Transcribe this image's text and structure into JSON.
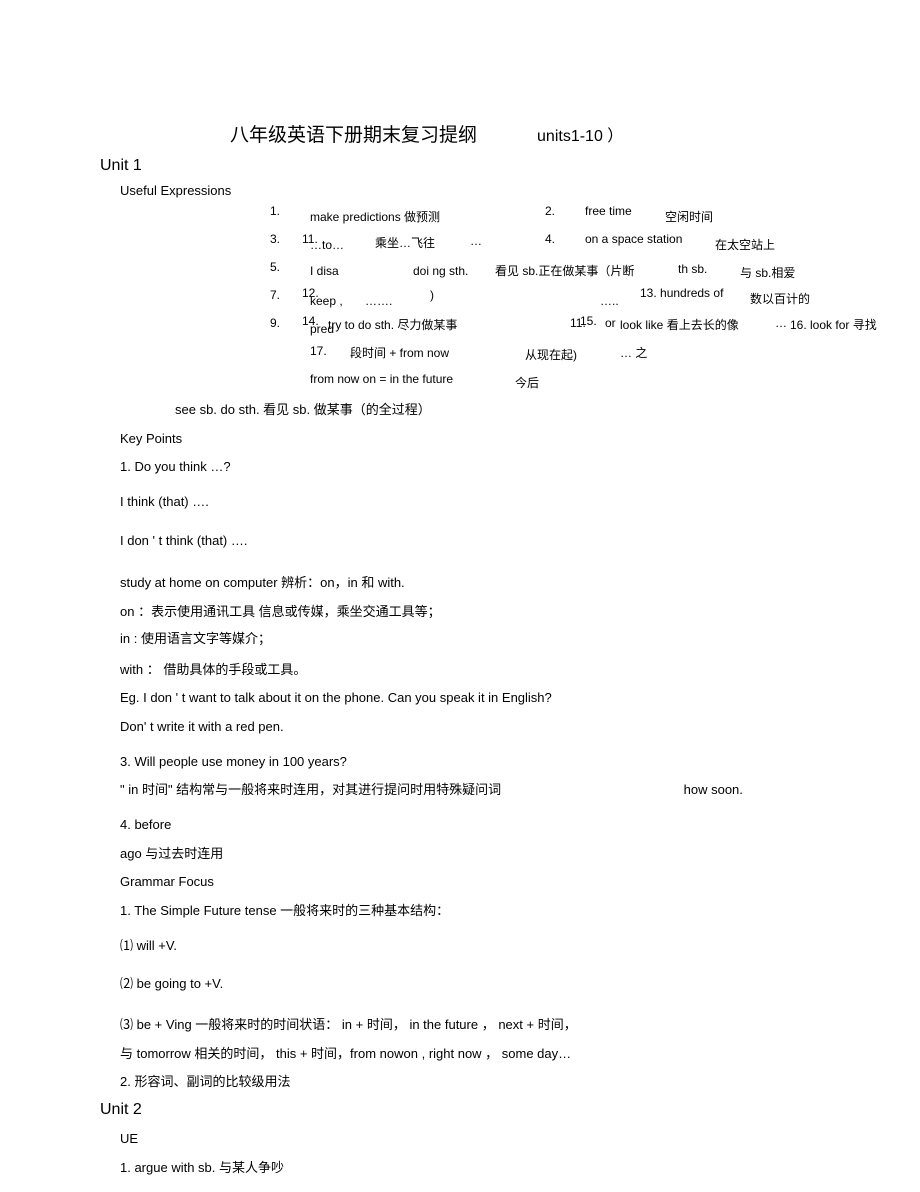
{
  "title": {
    "main": "八年级英语下册期末复习提纲",
    "units": "units1-10 ）"
  },
  "unit1": {
    "heading": "Unit 1",
    "ue_label": "Useful Expressions",
    "expr": {
      "n1": "1.",
      "e1a": "make predictions 做预测",
      "n2": "2.",
      "e2a": "free time",
      "e2b": "空闲时间",
      "n3": "3.",
      "e3a": "11.",
      "e3b": "…to…",
      "e3c": "乘坐…飞往",
      "e3d": "…",
      "n4": "4.",
      "e4a": "on a space station",
      "e4b": "在太空站上",
      "n5": "5.",
      "e5a": "I disa",
      "e5b": "doi ng sth.",
      "e5c": "看见 sb.正在做某事（片断",
      "e5d": "th sb.",
      "e5e": "与 sb.相爱",
      "n7": "7.",
      "e7a": "12.",
      "e7b": "keep ,",
      "e7c": "…….",
      "e7d": ")",
      "e7e": "…..",
      "e7f": "13. hundreds of",
      "e7g": "数以百计的",
      "n9": "9.",
      "e9a": "14.",
      "e9b": "pred",
      "e9c": "try to do sth. 尽力做某事",
      "e9d": "11.",
      "e9e": "15.",
      "e9f": "or",
      "e9g": "look like 看上去长的像",
      "e9h": "…",
      "e9i": "16. look for 寻找",
      "e17a": "17.",
      "e17b": "段时间  + from now",
      "e17c": "从现在起)",
      "e17d": "… 之",
      "e18a": "from now on = in the future",
      "e18b": "今后"
    },
    "see_line": "see sb. do sth. 看见  sb. 做某事（的全过程）",
    "kp_label": "Key Points",
    "kp1": "1.       Do you think …?",
    "kp_think": "I think (that) ….",
    "kp_dont": "I don ' t think (that) ….",
    "kp_study": "study at home on computer 辨析：on，in 和  with.",
    "kp_on": "on ：表示使用通讯工具   信息或传媒，乘坐交通工具等；",
    "kp_in": "in : 使用语言文字等媒介；",
    "kp_with": "with ： 借助具体的手段或工具。",
    "kp_eg1": "Eg. I don '  t want to talk about it on the phone. Can you speak it in English?",
    "kp_eg2": "Don'  t write it with a red pen.",
    "kp3": "3. Will people use money in 100 years?",
    "kp3a_left": "\" in 时间\" 结构常与一般将来时连用，对其进行提问时用特殊疑问词",
    "kp3a_right": "how soon.",
    "kp4": "4.    before",
    "kp4a": "ago 与过去时连用",
    "gf_label": "Grammar Focus",
    "gf1": "1.  The Simple Future tense 一般将来时的三种基本结构：",
    "gf1a": "⑴  will +V.",
    "gf1b": "⑵  be going to +V.",
    "gf1c": "⑶ be + Ving 一般将来时的时间状语：   in + 时间，  in the future ， next + 时间，",
    "gf1d": "与 tomorrow 相关的时间，   this + 时间，from nowon , right now ， some day…",
    "gf2": "2.    形容词、副词的比较级用法"
  },
  "unit2": {
    "heading": "Unit 2",
    "ue_label": "UE",
    "item1": "1.  argue with sb. 与某人争吵"
  }
}
